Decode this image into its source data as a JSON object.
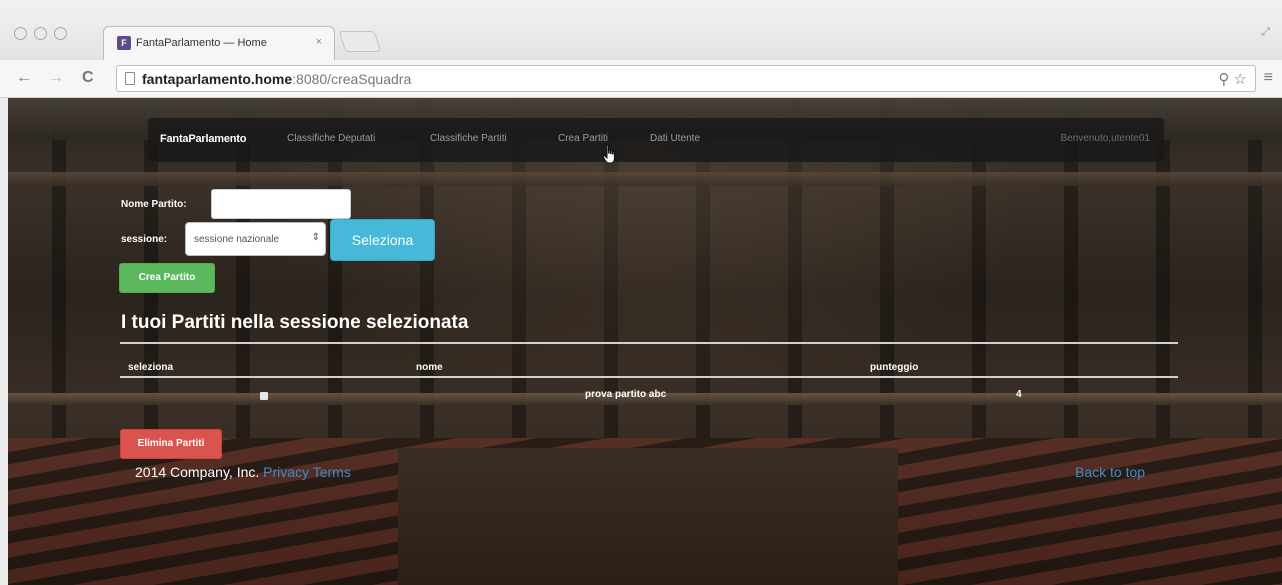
{
  "window": {
    "tab_title": "FantaParlamento — Home",
    "tab_close": "×",
    "favicon": "F"
  },
  "toolbar": {
    "back": "←",
    "forward": "→",
    "reload": "C",
    "url_host": "fantaparlamento.home",
    "url_rest": ":8080/creaSquadra",
    "search_icon": "⚲",
    "star_icon": "☆",
    "menu_icon": "≡"
  },
  "navbar": {
    "brand": "FantaParlamento",
    "links": [
      "Classifiche Deputati",
      "Classifiche Partiti",
      "Crea Partiti",
      "Dati Utente"
    ],
    "welcome": "Benvenuto,utente01"
  },
  "form": {
    "nome_label": "Nome Partito:",
    "nome_value": "",
    "sessione_label": "sessione:",
    "sessione_selected": "sessione nazionale",
    "seleziona_button": "Seleziona",
    "crea_button": "Crea Partito"
  },
  "section": {
    "title": "I tuoi Partiti nella sessione selezionata"
  },
  "table": {
    "headers": [
      "seleziona",
      "nome",
      "punteggio"
    ],
    "rows": [
      {
        "checked": false,
        "nome": "prova partito abc",
        "punteggio": "4"
      }
    ]
  },
  "actions": {
    "elimina_button": "Elimina Partiti"
  },
  "footer": {
    "copyright": "2014 Company, Inc.",
    "privacy": "Privacy",
    "terms": "Terms",
    "back_to_top": "Back to top"
  },
  "colors": {
    "primary_link": "#428bca",
    "info": "#46b8da",
    "success": "#5cb85c",
    "danger": "#d9534f"
  }
}
